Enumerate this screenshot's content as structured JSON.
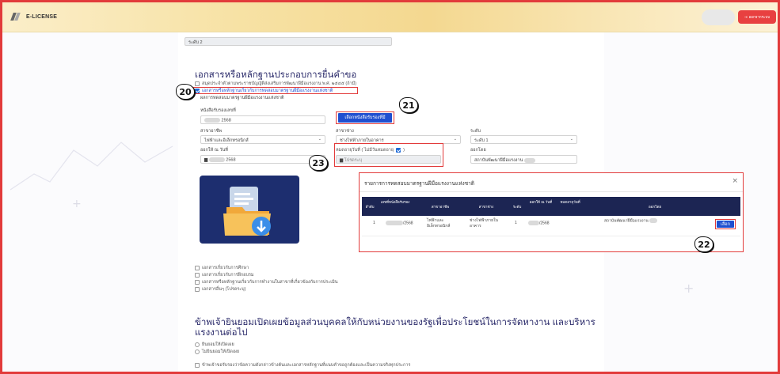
{
  "header": {
    "app_name": "E-LICENSE",
    "logout_label": "ออกจากระบบ"
  },
  "form": {
    "level_top_value": "ระดับ 2",
    "section_title": "เอกสารหรือหลักฐานประกอบการยื่นคำขอ",
    "cb_labor_card": "สมุดประจำตัวตามพระราชบัญญัติส่งเสริมการพัฒนาฝีมือแรงงาน พ.ศ. ๒๕๔๕ (ถ้ามี)",
    "cb_standard_test": "เอกสารหรือหลักฐานเกี่ยวกับการทดสอบมาตรฐานฝีมือแรงงานแห่งชาติ",
    "sub_label": "ผลการทดสอบมาตรฐานฝีมือแรงงานแห่งชาติ",
    "cert_no_label": "หนังสือรับรองเลขที่",
    "cert_no_value": "2568",
    "select_cert_button": "เลือกหนังสือรับรองที่มี",
    "branch_label": "สาขาอาชีพ",
    "branch_value": "ไฟฟ้าและอิเล็กทรอนิกส์",
    "trade_label": "สาขาช่าง",
    "trade_value": "ช่างไฟฟ้าภายในอาคาร",
    "level_label": "ระดับ",
    "level_value": "ระดับ 1",
    "issued_label": "ออกให้ ณ วันที่",
    "issued_value": "2568",
    "expiry_label": "หมดอายุวันที่ ( ไม่มีวันหมดอายุ",
    "expiry_checked_suffix": ")",
    "expiry_placeholder": "โปรดระบุ",
    "issued_by_label": "ออกโดย",
    "issued_by_value": "สถาบันพัฒนาฝีมือแรงงาน",
    "cb_education": "เอกสารเกี่ยวกับการศึกษา",
    "cb_training": "เอกสารเกี่ยวกับการฝึกอบรม",
    "cb_work": "เอกสารหรือหลักฐานเกี่ยวกับการทำงานในสาขาที่เกี่ยวข้องกับการประเมิน",
    "cb_other": "เอกสารอื่นๆ (โปรดระบุ)",
    "consent_title": "ข้าพเจ้ายินยอมเปิดเผยข้อมูลส่วนบุคคลให้กับหน่วยงานของรัฐเพื่อประโยชน์ในการจัดหางาน และบริหารแรงงานต่อไป",
    "consent_yes": "ยินยอมให้เปิดเผย",
    "consent_no": "ไม่ยินยอมให้เปิดเผย",
    "certify_text": "ข้าพเจ้าขอรับรองว่าข้อความดังกล่าวข้างต้นและเอกสารหลักฐานที่แนบคำขอถูกต้องและเป็นความจริงทุกประการ"
  },
  "badges": [
    "20",
    "21",
    "22",
    "23"
  ],
  "modal": {
    "title": "รายการการทดสอบมาตรฐานฝีมือแรงงานแห่งชาติ",
    "columns": [
      "ลำดับ",
      "เลขที่หนังสือรับรอง",
      "สาขาอาชีพ",
      "สาขาช่าง",
      "ระดับ",
      "ออกให้ ณ วันที่",
      "หมดอายุวันที่",
      "ออกโดย"
    ],
    "row": {
      "index": "1",
      "cert_no": "/2568",
      "branch": "ไฟฟ้าและอิเล็กทรอนิกส์",
      "trade": "ช่างไฟฟ้าภายในอาคาร",
      "level": "1",
      "issued": "/2568",
      "expiry": "",
      "issued_by": "สถาบันพัฒนาฝีมือแรงงาน",
      "select_label": "เลือก"
    }
  },
  "colors": {
    "highlight": "#e23b3b",
    "primary_blue": "#1f4fd0",
    "table_header": "#1c2553",
    "logout_red": "#e84040"
  }
}
